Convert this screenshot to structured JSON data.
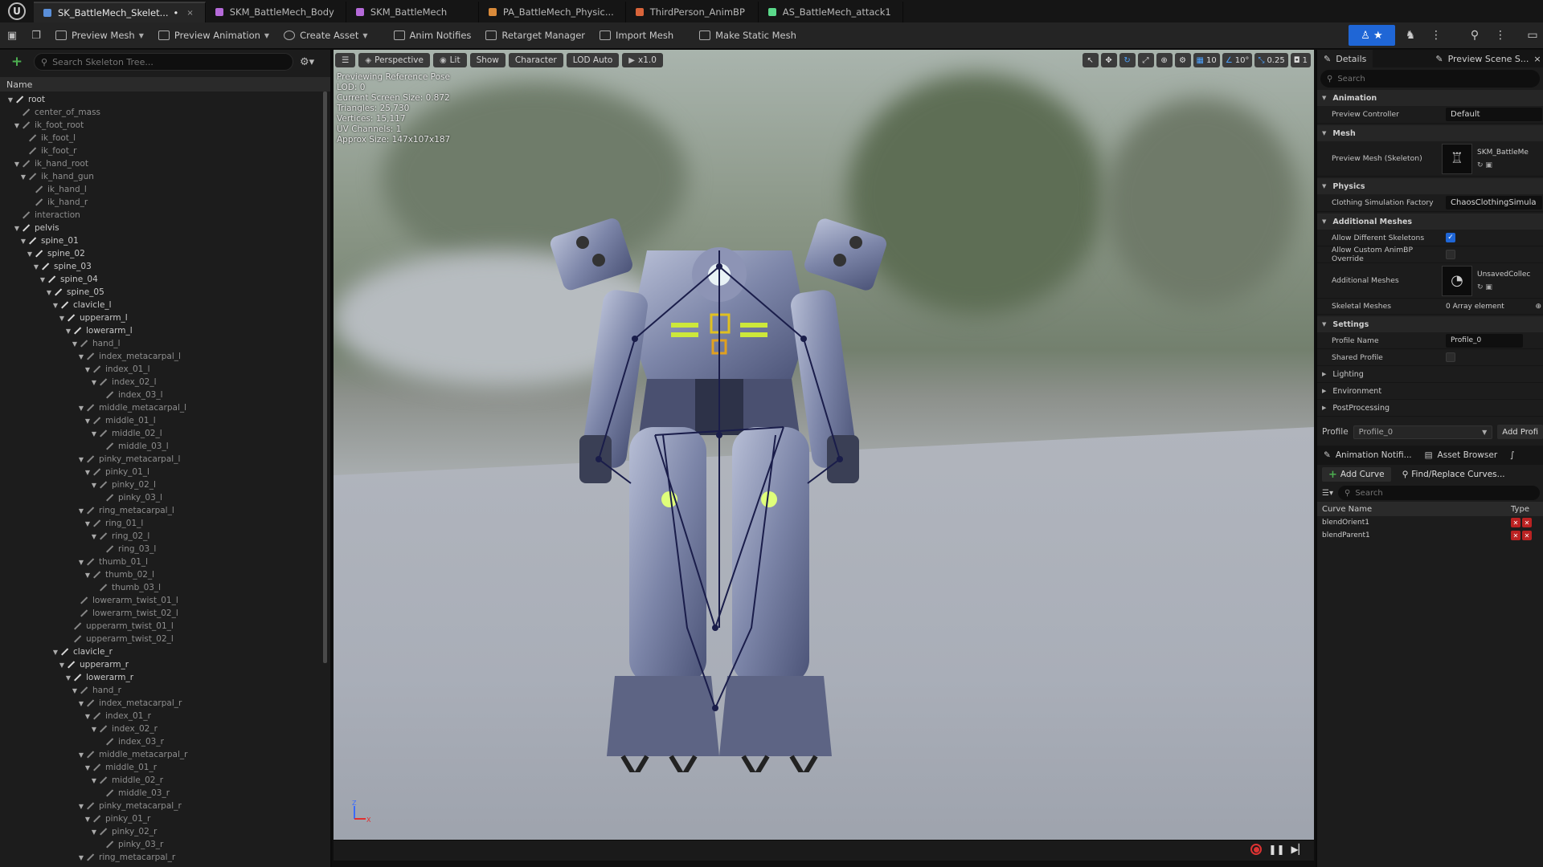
{
  "tabs": [
    {
      "label": "SK_BattleMech_Skelet...",
      "modified": "•",
      "close": "×",
      "color": "#5a8fd9",
      "active": true
    },
    {
      "label": "SKM_BattleMech_Body",
      "color": "#b56ad9",
      "active": false
    },
    {
      "label": "SKM_BattleMech",
      "color": "#b56ad9",
      "active": false
    },
    {
      "label": "PA_BattleMech_Physic...",
      "color": "#d98a3a",
      "active": false
    },
    {
      "label": "ThirdPerson_AnimBP",
      "color": "#d9643a",
      "active": false
    },
    {
      "label": "AS_BattleMech_attack1",
      "color": "#5ad98a",
      "active": false
    }
  ],
  "toolbar": {
    "preview_mesh": "Preview Mesh",
    "preview_animation": "Preview Animation",
    "create_asset": "Create Asset",
    "anim_notifies": "Anim Notifies",
    "retarget_manager": "Retarget Manager",
    "import_mesh": "Import Mesh",
    "make_static_mesh": "Make Static Mesh"
  },
  "skeleton_tree": {
    "search_placeholder": "Search Skeleton Tree...",
    "column_name": "Name",
    "bones": [
      {
        "name": "root",
        "depth": 0,
        "arrow": "▼",
        "dim": false
      },
      {
        "name": "center_of_mass",
        "depth": 1,
        "arrow": "",
        "dim": true
      },
      {
        "name": "ik_foot_root",
        "depth": 1,
        "arrow": "▼",
        "dim": true
      },
      {
        "name": "ik_foot_l",
        "depth": 2,
        "arrow": "",
        "dim": true
      },
      {
        "name": "ik_foot_r",
        "depth": 2,
        "arrow": "",
        "dim": true
      },
      {
        "name": "ik_hand_root",
        "depth": 1,
        "arrow": "▼",
        "dim": true
      },
      {
        "name": "ik_hand_gun",
        "depth": 2,
        "arrow": "▼",
        "dim": true
      },
      {
        "name": "ik_hand_l",
        "depth": 3,
        "arrow": "",
        "dim": true
      },
      {
        "name": "ik_hand_r",
        "depth": 3,
        "arrow": "",
        "dim": true
      },
      {
        "name": "interaction",
        "depth": 1,
        "arrow": "",
        "dim": true
      },
      {
        "name": "pelvis",
        "depth": 1,
        "arrow": "▼",
        "dim": false
      },
      {
        "name": "spine_01",
        "depth": 2,
        "arrow": "▼",
        "dim": false
      },
      {
        "name": "spine_02",
        "depth": 3,
        "arrow": "▼",
        "dim": false
      },
      {
        "name": "spine_03",
        "depth": 4,
        "arrow": "▼",
        "dim": false
      },
      {
        "name": "spine_04",
        "depth": 5,
        "arrow": "▼",
        "dim": false
      },
      {
        "name": "spine_05",
        "depth": 6,
        "arrow": "▼",
        "dim": false
      },
      {
        "name": "clavicle_l",
        "depth": 7,
        "arrow": "▼",
        "dim": false
      },
      {
        "name": "upperarm_l",
        "depth": 8,
        "arrow": "▼",
        "dim": false
      },
      {
        "name": "lowerarm_l",
        "depth": 9,
        "arrow": "▼",
        "dim": false
      },
      {
        "name": "hand_l",
        "depth": 10,
        "arrow": "▼",
        "dim": true
      },
      {
        "name": "index_metacarpal_l",
        "depth": 11,
        "arrow": "▼",
        "dim": true
      },
      {
        "name": "index_01_l",
        "depth": 12,
        "arrow": "▼",
        "dim": true
      },
      {
        "name": "index_02_l",
        "depth": 13,
        "arrow": "▼",
        "dim": true
      },
      {
        "name": "index_03_l",
        "depth": 14,
        "arrow": "",
        "dim": true
      },
      {
        "name": "middle_metacarpal_l",
        "depth": 11,
        "arrow": "▼",
        "dim": true
      },
      {
        "name": "middle_01_l",
        "depth": 12,
        "arrow": "▼",
        "dim": true
      },
      {
        "name": "middle_02_l",
        "depth": 13,
        "arrow": "▼",
        "dim": true
      },
      {
        "name": "middle_03_l",
        "depth": 14,
        "arrow": "",
        "dim": true
      },
      {
        "name": "pinky_metacarpal_l",
        "depth": 11,
        "arrow": "▼",
        "dim": true
      },
      {
        "name": "pinky_01_l",
        "depth": 12,
        "arrow": "▼",
        "dim": true
      },
      {
        "name": "pinky_02_l",
        "depth": 13,
        "arrow": "▼",
        "dim": true
      },
      {
        "name": "pinky_03_l",
        "depth": 14,
        "arrow": "",
        "dim": true
      },
      {
        "name": "ring_metacarpal_l",
        "depth": 11,
        "arrow": "▼",
        "dim": true
      },
      {
        "name": "ring_01_l",
        "depth": 12,
        "arrow": "▼",
        "dim": true
      },
      {
        "name": "ring_02_l",
        "depth": 13,
        "arrow": "▼",
        "dim": true
      },
      {
        "name": "ring_03_l",
        "depth": 14,
        "arrow": "",
        "dim": true
      },
      {
        "name": "thumb_01_l",
        "depth": 11,
        "arrow": "▼",
        "dim": true
      },
      {
        "name": "thumb_02_l",
        "depth": 12,
        "arrow": "▼",
        "dim": true
      },
      {
        "name": "thumb_03_l",
        "depth": 13,
        "arrow": "",
        "dim": true
      },
      {
        "name": "lowerarm_twist_01_l",
        "depth": 10,
        "arrow": "",
        "dim": true
      },
      {
        "name": "lowerarm_twist_02_l",
        "depth": 10,
        "arrow": "",
        "dim": true
      },
      {
        "name": "upperarm_twist_01_l",
        "depth": 9,
        "arrow": "",
        "dim": true
      },
      {
        "name": "upperarm_twist_02_l",
        "depth": 9,
        "arrow": "",
        "dim": true
      },
      {
        "name": "clavicle_r",
        "depth": 7,
        "arrow": "▼",
        "dim": false
      },
      {
        "name": "upperarm_r",
        "depth": 8,
        "arrow": "▼",
        "dim": false
      },
      {
        "name": "lowerarm_r",
        "depth": 9,
        "arrow": "▼",
        "dim": false
      },
      {
        "name": "hand_r",
        "depth": 10,
        "arrow": "▼",
        "dim": true
      },
      {
        "name": "index_metacarpal_r",
        "depth": 11,
        "arrow": "▼",
        "dim": true
      },
      {
        "name": "index_01_r",
        "depth": 12,
        "arrow": "▼",
        "dim": true
      },
      {
        "name": "index_02_r",
        "depth": 13,
        "arrow": "▼",
        "dim": true
      },
      {
        "name": "index_03_r",
        "depth": 14,
        "arrow": "",
        "dim": true
      },
      {
        "name": "middle_metacarpal_r",
        "depth": 11,
        "arrow": "▼",
        "dim": true
      },
      {
        "name": "middle_01_r",
        "depth": 12,
        "arrow": "▼",
        "dim": true
      },
      {
        "name": "middle_02_r",
        "depth": 13,
        "arrow": "▼",
        "dim": true
      },
      {
        "name": "middle_03_r",
        "depth": 14,
        "arrow": "",
        "dim": true
      },
      {
        "name": "pinky_metacarpal_r",
        "depth": 11,
        "arrow": "▼",
        "dim": true
      },
      {
        "name": "pinky_01_r",
        "depth": 12,
        "arrow": "▼",
        "dim": true
      },
      {
        "name": "pinky_02_r",
        "depth": 13,
        "arrow": "▼",
        "dim": true
      },
      {
        "name": "pinky_03_r",
        "depth": 14,
        "arrow": "",
        "dim": true
      },
      {
        "name": "ring_metacarpal_r",
        "depth": 11,
        "arrow": "▼",
        "dim": true
      }
    ]
  },
  "viewport": {
    "buttons": {
      "perspective": "Perspective",
      "lit": "Lit",
      "show": "Show",
      "character": "Character",
      "lod": "LOD Auto",
      "speed": "x1.0"
    },
    "right_values": {
      "grid": "10",
      "angle": "10°",
      "scale": "0.25",
      "camera": "1"
    },
    "info": [
      "Previewing Reference Pose",
      "LOD: 0",
      "Current Screen Size: 0.872",
      "Triangles: 25,730",
      "Vertices: 15,117",
      "UV Channels: 1",
      "Approx Size: 147x107x187"
    ],
    "axis_z": "Z",
    "axis_x": "X"
  },
  "details": {
    "tab_details": "Details",
    "tab_preview_scene": "Preview Scene S...",
    "search_placeholder": "Search",
    "sections": {
      "animation": "Animation",
      "mesh": "Mesh",
      "physics": "Physics",
      "additional_meshes": "Additional Meshes",
      "settings": "Settings"
    },
    "props": {
      "preview_controller_label": "Preview Controller",
      "preview_controller_value": "Default",
      "preview_mesh_label": "Preview Mesh (Skeleton)",
      "preview_mesh_value": "SKM_BattleMe",
      "clothing_label": "Clothing Simulation Factory",
      "clothing_value": "ChaosClothingSimula",
      "allow_diff_skel_label": "Allow Different Skeletons",
      "allow_custom_animbp_label": "Allow Custom AnimBP Override",
      "additional_meshes_label": "Additional Meshes",
      "additional_meshes_value": "UnsavedCollec",
      "skeletal_meshes_label": "Skeletal Meshes",
      "skeletal_meshes_value": "0 Array element",
      "profile_name_label": "Profile Name",
      "profile_name_value": "Profile_0",
      "shared_profile_label": "Shared Profile"
    },
    "collapsed": {
      "lighting": "Lighting",
      "environment": "Environment",
      "postprocessing": "PostProcessing"
    },
    "profile_label": "Profile",
    "profile_value": "Profile_0",
    "add_profile": "Add Profi"
  },
  "curves": {
    "tab_notifies": "Animation Notifi...",
    "tab_asset_browser": "Asset Browser",
    "add_curve": "Add Curve",
    "find_replace": "Find/Replace Curves...",
    "search_placeholder": "Search",
    "col_name": "Curve Name",
    "col_type": "Type",
    "rows": [
      "blendOrient1",
      "blendParent1"
    ]
  }
}
